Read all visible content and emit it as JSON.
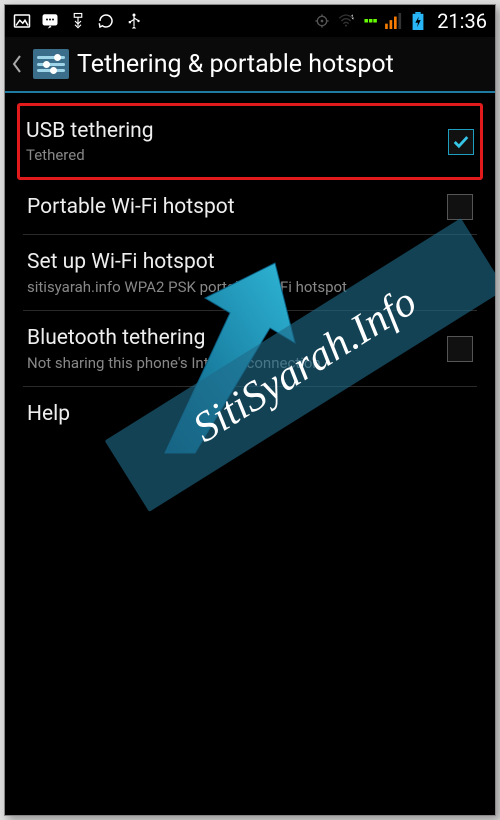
{
  "statusbar": {
    "clock": "21:36"
  },
  "header": {
    "title": "Tethering & portable hotspot"
  },
  "items": {
    "usb": {
      "title": "USB tethering",
      "sub": "Tethered"
    },
    "wifi": {
      "title": "Portable Wi-Fi hotspot"
    },
    "setup": {
      "title": "Set up Wi-Fi hotspot",
      "sub": "sitisyarah.info WPA2 PSK portable Wi-Fi hotspot"
    },
    "bt": {
      "title": "Bluetooth tethering",
      "sub": "Not sharing this phone's Internet connection"
    },
    "help": {
      "title": "Help"
    }
  },
  "watermark": "SitiSyarah.Info",
  "colors": {
    "accent": "#1f9fbf",
    "highlight_border": "#e11b1b",
    "overlay": "rgba(31,106,137,0.62)"
  }
}
